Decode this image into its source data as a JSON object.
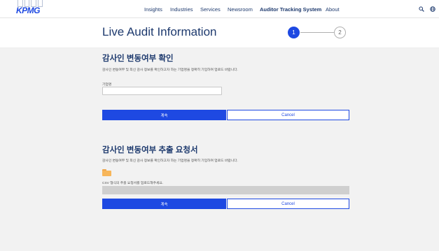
{
  "brand": {
    "logo_text": "KPMG",
    "accent_color": "#1e49e2",
    "text_color": "#1e3a6e"
  },
  "nav": {
    "items": [
      {
        "label": "Insights"
      },
      {
        "label": "Industries"
      },
      {
        "label": "Services"
      },
      {
        "label": "Newsroom"
      },
      {
        "label": "Auditor Tracking System",
        "active": true
      },
      {
        "label": "About"
      }
    ],
    "search_icon": "search-icon",
    "globe_icon": "globe-icon"
  },
  "header": {
    "title": "Live Audit Information",
    "steps": [
      {
        "label": "1",
        "active": true
      },
      {
        "label": "2",
        "active": false
      }
    ]
  },
  "section1": {
    "title": "감사인 변동여부 확인",
    "description": "감사인 변동여부 및 최신 감사 정보를 확인하고자 하는 기업명을 정확히 기입하여 업로드 바랍니다.",
    "field_label": "기업명",
    "input_value": "",
    "input_placeholder": "",
    "continue_label": "계속",
    "cancel_label": "Cancel"
  },
  "section2": {
    "title": "감사인 변동여부 추출 요청서",
    "description": "감사인 변동여부 및 최신 감사 정보를 확인하고자 하는 기업명을 정확히 기입하여 업로드 바랍니다.",
    "folder_icon": "folder-icon",
    "upload_label": "CSV 형식의 추출 요청서를 업로드해주세요.",
    "continue_label": "계속",
    "cancel_label": "Cancel"
  }
}
